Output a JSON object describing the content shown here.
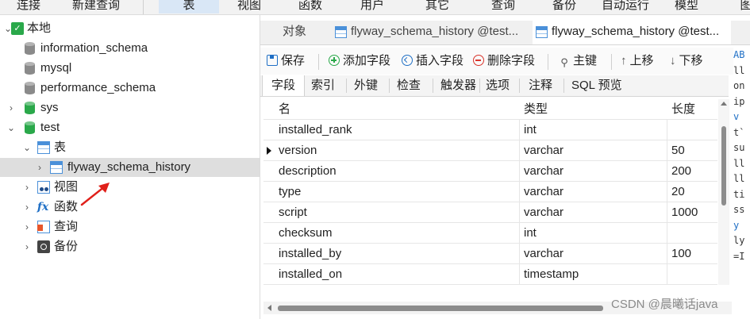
{
  "menu": {
    "items": [
      "连接",
      "新建查询",
      "表",
      "视图",
      "函数",
      "用户",
      "其它",
      "查询",
      "备份",
      "自动运行",
      "模型",
      "图"
    ],
    "active": "表"
  },
  "tree": {
    "root": "本地",
    "databases": [
      "information_schema",
      "mysql",
      "performance_schema",
      "sys",
      "test"
    ],
    "test_children": {
      "tables_folder": "表",
      "table": "flyway_schema_history",
      "views": "视图",
      "functions": "函数",
      "queries": "查询",
      "backups": "备份"
    }
  },
  "tabs": {
    "objects": "对象",
    "tab1": "flyway_schema_history @test...",
    "tab2": "flyway_schema_history @test..."
  },
  "toolbar": {
    "save": "保存",
    "add_field": "添加字段",
    "insert_field": "插入字段",
    "delete_field": "删除字段",
    "primary_key": "主键",
    "move_up": "上移",
    "move_down": "下移"
  },
  "subtabs": [
    "字段",
    "索引",
    "外键",
    "检查",
    "触发器",
    "选项",
    "注释",
    "SQL 预览"
  ],
  "grid": {
    "headers": {
      "name": "名",
      "type": "类型",
      "length": "长度"
    },
    "rows": [
      {
        "name": "installed_rank",
        "type": "int",
        "length": ""
      },
      {
        "name": "version",
        "type": "varchar",
        "length": "50"
      },
      {
        "name": "description",
        "type": "varchar",
        "length": "200"
      },
      {
        "name": "type",
        "type": "varchar",
        "length": "20"
      },
      {
        "name": "script",
        "type": "varchar",
        "length": "1000"
      },
      {
        "name": "checksum",
        "type": "int",
        "length": ""
      },
      {
        "name": "installed_by",
        "type": "varchar",
        "length": "100"
      },
      {
        "name": "installed_on",
        "type": "timestamp",
        "length": ""
      }
    ],
    "current_row": "version"
  },
  "code_strip": [
    "AB",
    "ll",
    "on",
    "ip",
    " v",
    "t`",
    "su",
    "ll",
    "ll",
    "ti",
    "ss",
    "y",
    "ly",
    "=I"
  ],
  "watermark": "CSDN @晨曦话java",
  "colors": {
    "accent": "#1f6fc5",
    "db_green": "#2aa84a",
    "arrow": "#e0201a"
  }
}
